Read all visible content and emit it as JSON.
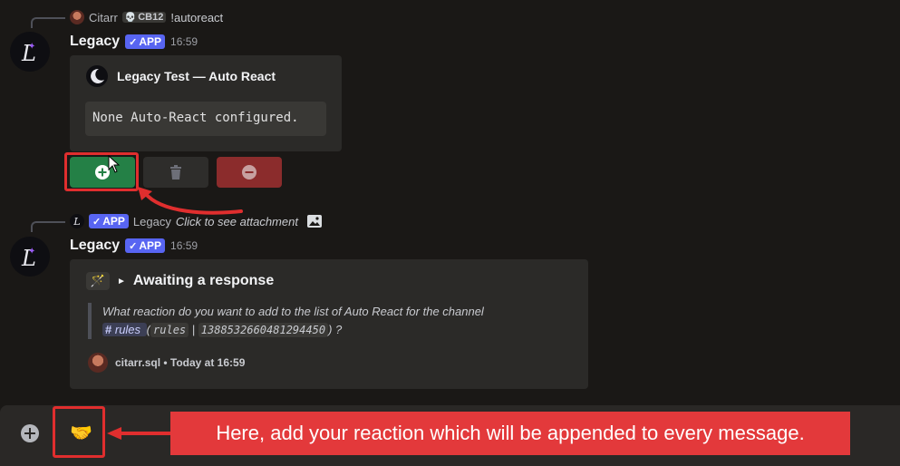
{
  "reply1": {
    "user": "Citarr",
    "tag": "CB12",
    "command": "!autoreact"
  },
  "msg1": {
    "username": "Legacy",
    "badge": "APP",
    "time": "16:59",
    "embed_title": "Legacy Test — Auto React",
    "embed_code": "None Auto-React configured."
  },
  "reply2": {
    "badge": "APP",
    "user": "Legacy",
    "text": "Click to see attachment"
  },
  "msg2": {
    "username": "Legacy",
    "badge": "APP",
    "time": "16:59",
    "embed_title": "Awaiting a response",
    "question_prefix": "What reaction do you want to add to the list of Auto React for the channel",
    "channel": "rules",
    "channel_code": "rules",
    "channel_id": "1388532660481294450",
    "question_suffix": "?",
    "footer": "citarr.sql • Today at 16:59"
  },
  "composer": {
    "emoji": "🤝"
  },
  "callout": {
    "text": "Here, add your reaction which will be appended to every message."
  },
  "colors": {
    "add_button": "#248046",
    "delete_button": "#2e2d2b",
    "remove_button": "#8b2c2c",
    "annotation_red": "#e02e2e",
    "app_badge": "#5865f2"
  },
  "icons": {
    "add": "plus-circle-icon",
    "delete": "trash-icon",
    "remove": "minus-circle-icon",
    "image": "image-icon",
    "composer_add": "plus-circle-icon"
  }
}
